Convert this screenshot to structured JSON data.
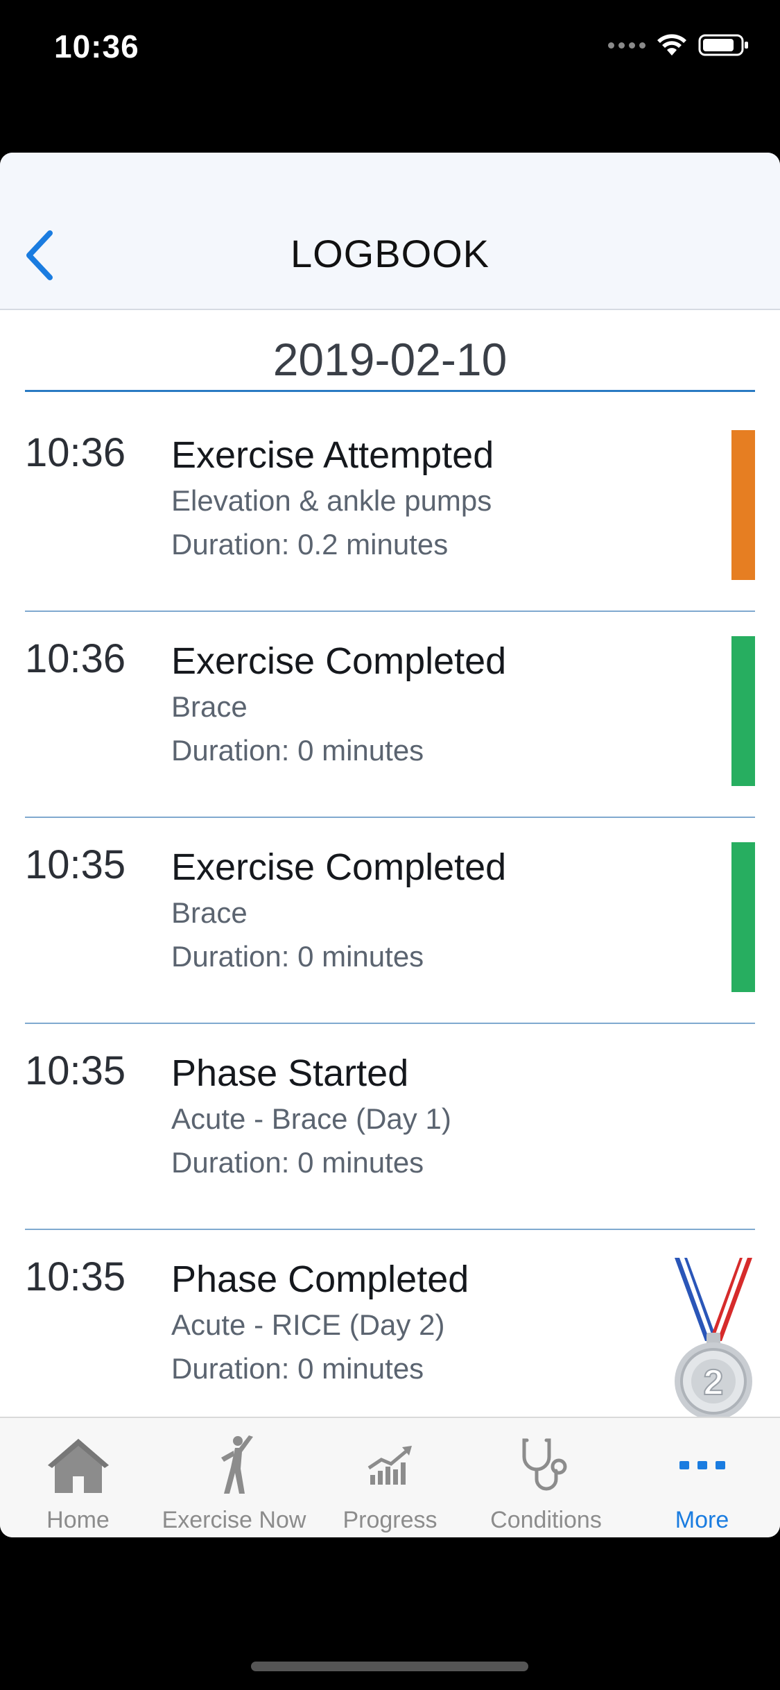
{
  "status_bar": {
    "time": "10:36"
  },
  "nav": {
    "title": "LOGBOOK"
  },
  "date_header": "2019-02-10",
  "log_entries": [
    {
      "time": "10:36",
      "title": "Exercise Attempted",
      "subtitle": "Elevation & ankle pumps",
      "duration": "Duration: 0.2 minutes",
      "indicator": "orange-bar"
    },
    {
      "time": "10:36",
      "title": "Exercise Completed",
      "subtitle": "Brace",
      "duration": "Duration: 0 minutes",
      "indicator": "green-bar"
    },
    {
      "time": "10:35",
      "title": "Exercise Completed",
      "subtitle": "Brace",
      "duration": "Duration: 0 minutes",
      "indicator": "green-bar"
    },
    {
      "time": "10:35",
      "title": "Phase Started",
      "subtitle": "Acute - Brace (Day 1)",
      "duration": "Duration: 0 minutes",
      "indicator": "none"
    },
    {
      "time": "10:35",
      "title": "Phase Completed",
      "subtitle": "Acute - RICE (Day 2)",
      "duration": "Duration: 0 minutes",
      "indicator": "silver-medal-icon"
    }
  ],
  "tabs": [
    {
      "label": "Home",
      "icon": "home-icon",
      "active": false
    },
    {
      "label": "Exercise Now",
      "icon": "exercise-figure-icon",
      "active": false
    },
    {
      "label": "Progress",
      "icon": "progress-chart-icon",
      "active": false
    },
    {
      "label": "Conditions",
      "icon": "stethoscope-icon",
      "active": false
    },
    {
      "label": "More",
      "icon": "more-dots-icon",
      "active": true
    }
  ],
  "colors": {
    "accent": "#1a7ce0",
    "attempted": "#e67e22",
    "completed": "#27ae60",
    "divider": "#7fa9cf",
    "date_underline": "#2a7ac3"
  }
}
